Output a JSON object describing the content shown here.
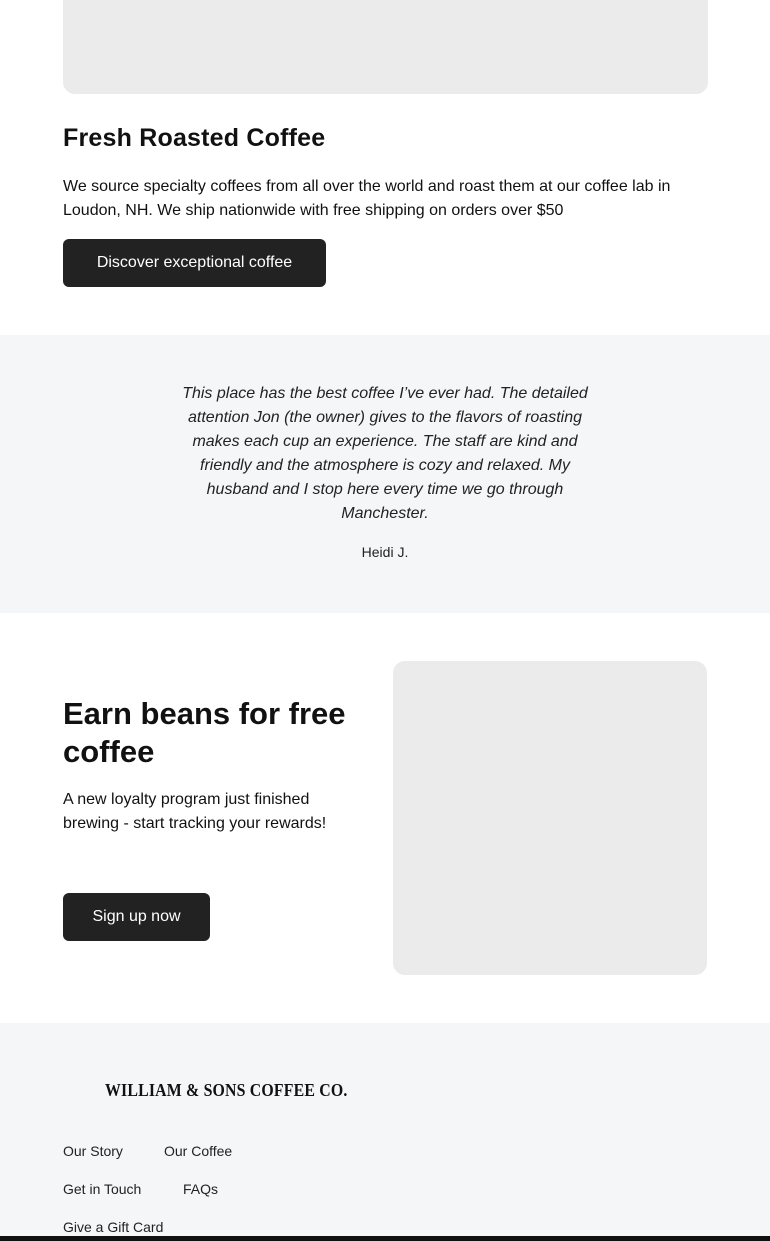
{
  "fresh": {
    "title": "Fresh Roasted Coffee",
    "description": "We source specialty coffees from all over the world and roast them at our coffee lab in Loudon, NH. We ship nationwide with free shipping on orders over $50",
    "button_label": "Discover exceptional coffee"
  },
  "testimonial": {
    "quote": "This place has the best coffee I’ve ever had. The detailed attention Jon (the owner) gives to the flavors of roasting makes each cup an experience. The staff are kind and friendly and the atmosphere is cozy and relaxed. My husband and I stop here every time we go through Manchester.",
    "author": "Heidi J."
  },
  "loyalty": {
    "title": "Earn beans for free coffee",
    "description": "A new loyalty program just finished brewing - start tracking your rewards!",
    "button_label": "Sign up now"
  },
  "footer": {
    "logo_text": "WILLIAM & SONS COFFEE CO.",
    "links": [
      "Our Story",
      "Our Coffee",
      "Get in Touch",
      "FAQs",
      "Give a Gift Card"
    ]
  },
  "colors": {
    "button_bg": "#222222",
    "section_bg": "#f5f6f8",
    "image_placeholder": "#ebebeb"
  }
}
